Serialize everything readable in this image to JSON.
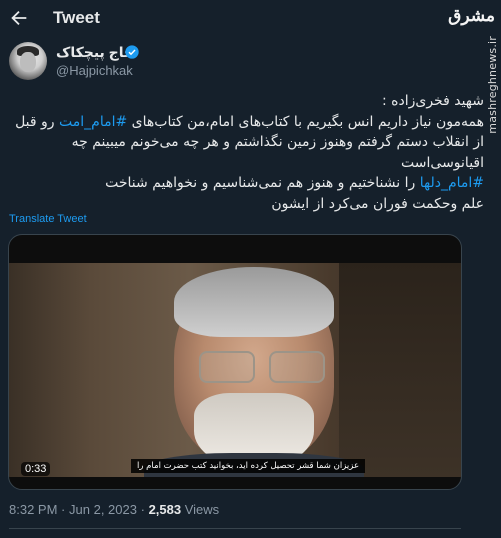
{
  "header": {
    "title": "Tweet",
    "back_icon": "arrow-left-icon"
  },
  "watermark": {
    "logo": "مشرق",
    "site": "mashreghnews.ir"
  },
  "author": {
    "display_name": "حاج پیچکاک",
    "handle": "@Hajpichkak",
    "verified": true,
    "verified_color": "#1d9bf0"
  },
  "tweet": {
    "line1": "شهید فخری‌زاده :",
    "line2_pre": "همه‌مون نیاز داریم انس بگیریم با کتاب‌های امام،من کتاب‌های ",
    "line2_hashtag": "#امام_امت",
    "line2_post": " رو قبل",
    "line3": "از انقلاب دستم گرفتم وهنوز زمین نگذاشتم و هر چه می‌خونم میبینم چه",
    "line4": "اقیانوسی‌است",
    "line5_hashtag": "#امام_دلها",
    "line5_post": " را نشناختیم و هنوز هم نمی‌شناسیم و نخواهیم شناخت",
    "line6": "علم وحکمت فوران می‌کرد از ایشون"
  },
  "translate_label": "Translate Tweet",
  "media": {
    "subtitle": "عزیزان شما قشر تحصیل کرده اید، بخوانید کتب حضرت امام را",
    "duration": "0:33"
  },
  "meta": {
    "time": "8:32 PM",
    "separator": "·",
    "date": "Jun 2, 2023",
    "views_count": "2,583",
    "views_label": "Views"
  },
  "colors": {
    "background": "#15202b",
    "accent": "#1d9bf0",
    "text": "#e7e9ea",
    "muted": "#8b98a5"
  }
}
